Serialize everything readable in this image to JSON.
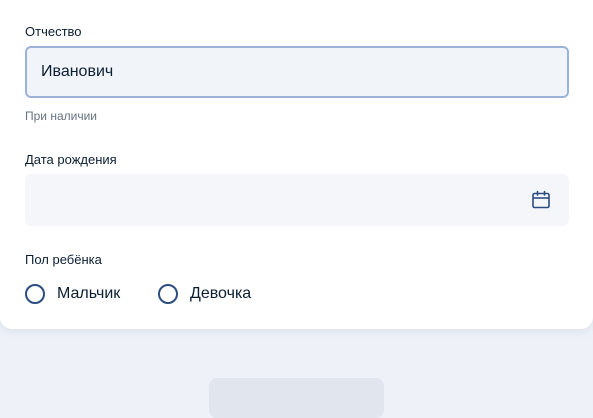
{
  "form": {
    "patronymic": {
      "label": "Отчество",
      "value": "Иванович",
      "hint": "При наличии"
    },
    "birth_date": {
      "label": "Дата рождения",
      "value": "",
      "icon": "calendar-icon"
    },
    "gender": {
      "label": "Пол ребёнка",
      "options": [
        "Мальчик",
        "Девочка"
      ],
      "selected": null
    }
  },
  "colors": {
    "accent": "#2b4d80",
    "focus_border": "#9bb3d9",
    "field_bg": "#f4f6fa",
    "hint_text": "#66727f"
  }
}
